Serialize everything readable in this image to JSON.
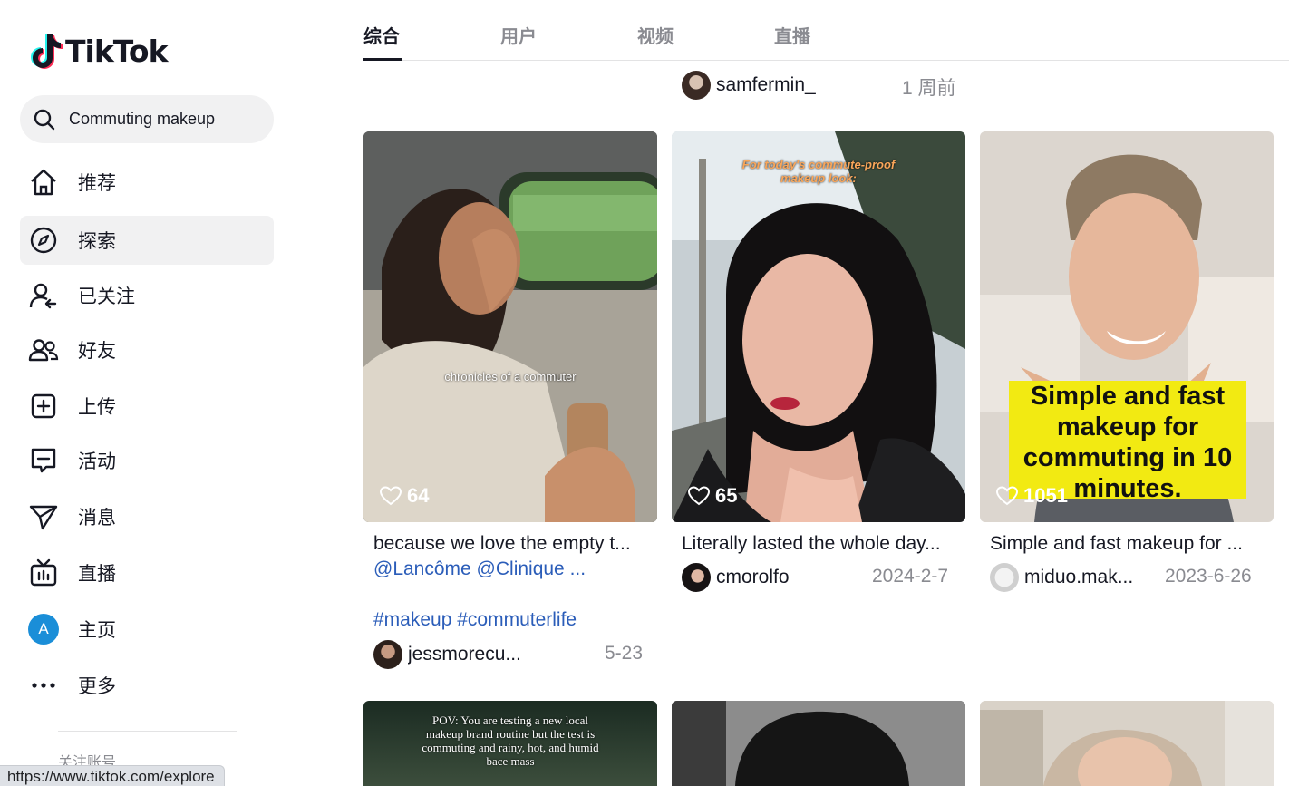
{
  "app": {
    "name": "TikTok"
  },
  "search": {
    "value": "Commuting makeup"
  },
  "nav": [
    {
      "label": "推荐",
      "icon": "home-icon"
    },
    {
      "label": "探索",
      "icon": "compass-icon"
    },
    {
      "label": "已关注",
      "icon": "following-icon"
    },
    {
      "label": "好友",
      "icon": "friends-icon"
    },
    {
      "label": "上传",
      "icon": "upload-icon"
    },
    {
      "label": "活动",
      "icon": "activity-icon"
    },
    {
      "label": "消息",
      "icon": "messages-icon"
    },
    {
      "label": "直播",
      "icon": "live-icon"
    },
    {
      "label": "主页",
      "icon": "profile-avatar",
      "avatar_letter": "A"
    },
    {
      "label": "更多",
      "icon": "more-icon"
    }
  ],
  "follow_section_title": "关注账号",
  "status_url": "https://www.tiktok.com/explore",
  "tabs": [
    "综合",
    "用户",
    "视频",
    "直播"
  ],
  "top_partial": {
    "author": "samfermin_",
    "date": "1 周前"
  },
  "videos": [
    {
      "likes": "64",
      "overlay": "chronicles of a commuter",
      "caption": "because we love the empty t...",
      "tags_line1": "@Lancôme @Clinique ...",
      "tags_line2": "#makeup #commuterlife",
      "author": "jessmorecu...",
      "date": "5-23"
    },
    {
      "likes": "65",
      "overlay": "For today's commute-proof makeup look:",
      "caption": "Literally lasted the whole day...",
      "author": "cmorolfo",
      "date": "2024-2-7"
    },
    {
      "likes": "1051",
      "overlay": "Simple and fast makeup for commuting in 10 minutes.",
      "caption": "Simple and fast makeup for ...",
      "author": "miduo.mak...",
      "date": "2023-6-26"
    }
  ],
  "bottom_row": [
    {
      "overlay": "POV: You are testing a new local makeup brand routine but the test is commuting and rainy, hot, and humid bace mass"
    },
    {
      "overlay": ""
    },
    {
      "overlay": ""
    }
  ],
  "colors": {
    "accent_link": "#2b5db9",
    "muted": "#8a8b91",
    "active_bg": "#f1f1f2",
    "avatar_blue": "#1a8ed8"
  }
}
